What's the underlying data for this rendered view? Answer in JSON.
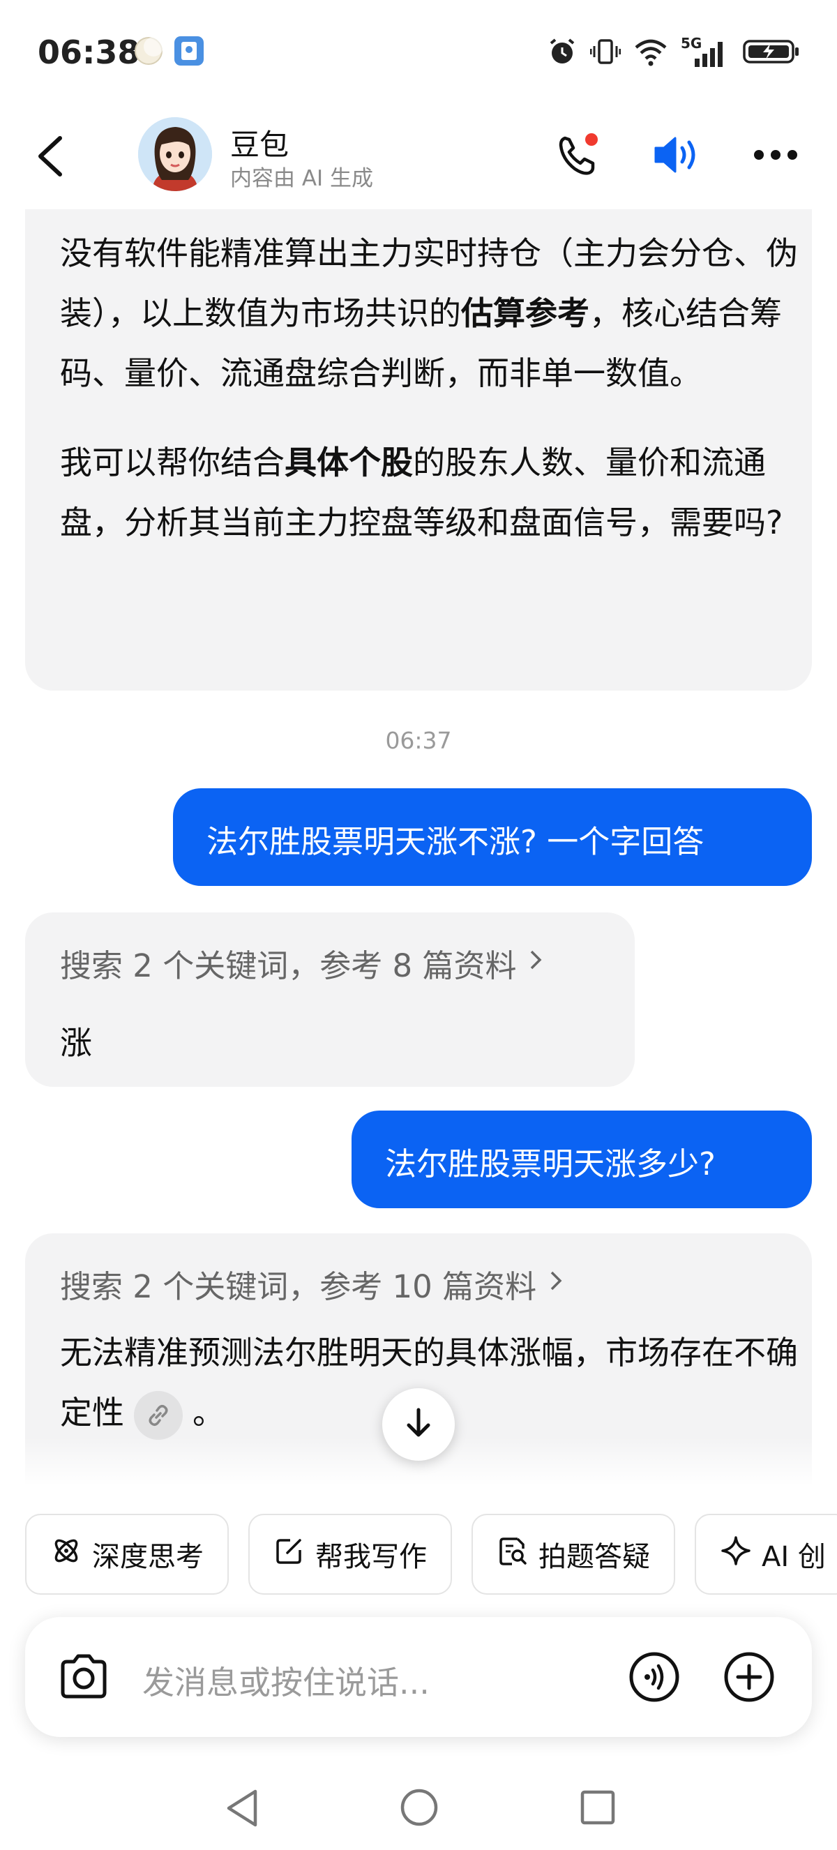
{
  "status_bar": {
    "time": "06:38",
    "network_label": "5G"
  },
  "header": {
    "name": "豆包",
    "subtitle": "内容由 AI 生成"
  },
  "messages": {
    "ai1": {
      "p1_a": "没有软件能精准算出主力实时持仓（主力会分仓、伪装），以上数值为市场共识的",
      "p1_b": "估算参考",
      "p1_c": "，核心结合筹码、量价、流通盘综合判断，而非单一数值。",
      "p2_a": "我可以帮你结合",
      "p2_b": "具体个股",
      "p2_c": "的股东人数、量价和流通盘，分析其当前主力控盘等级和盘面信号，需要吗?"
    },
    "timestamp": "06:37",
    "user1": "法尔胜股票明天涨不涨? 一个字回答",
    "ai2": {
      "search": "搜索 2 个关键词，参考 8 篇资料",
      "answer": "涨"
    },
    "user2": "法尔胜股票明天涨多少?",
    "ai3": {
      "search": "搜索 2 个关键词，参考 10 篇资料",
      "answer_a": "无法精准预测法尔胜明天的具体涨幅，市场存在不确定性",
      "answer_b": "。"
    }
  },
  "quick_actions": [
    "深度思考",
    "帮我写作",
    "拍题答疑",
    "AI 创"
  ],
  "input": {
    "placeholder": "发消息或按住说话..."
  },
  "colors": {
    "accent": "#0b63f3",
    "ai_bubble": "#f3f3f4"
  }
}
